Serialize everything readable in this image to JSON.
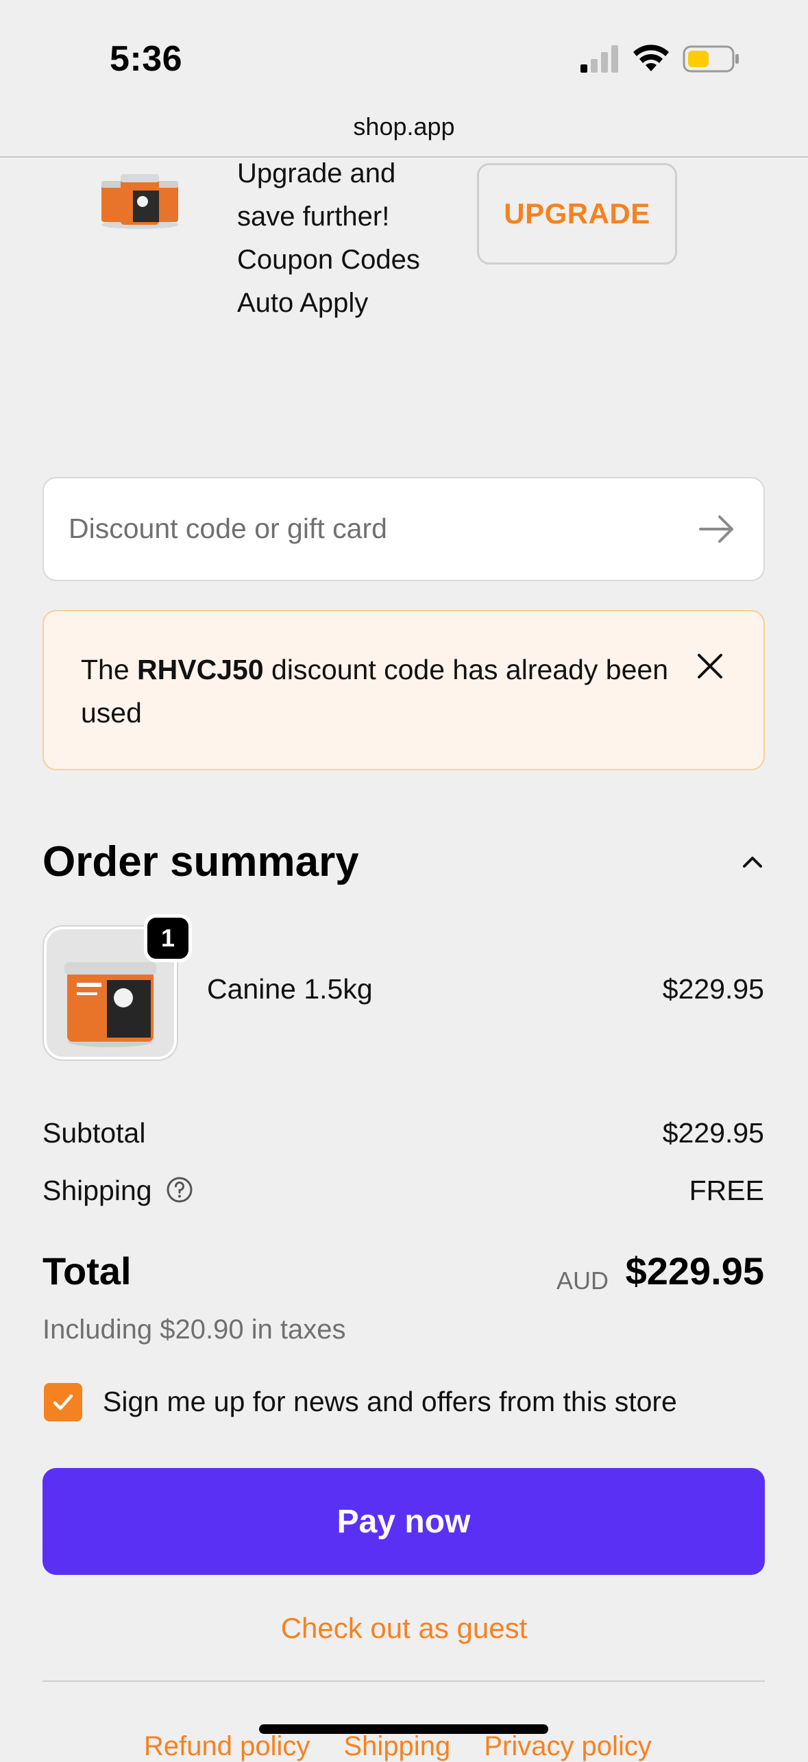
{
  "status_bar": {
    "time": "5:36",
    "battery_color": "#ffcc00"
  },
  "url_bar": {
    "url": "shop.app"
  },
  "upsell": {
    "text": "Upgrade and save further! Coupon Codes Auto Apply",
    "button_label": "UPGRADE"
  },
  "discount": {
    "placeholder": "Discount code or gift card"
  },
  "alert": {
    "prefix": "The ",
    "code": "RHVCJ50",
    "suffix": " discount code has already been used"
  },
  "order_summary": {
    "title": "Order summary",
    "items": [
      {
        "name": "Canine 1.5kg",
        "price": "$229.95",
        "quantity": "1"
      }
    ],
    "subtotal_label": "Subtotal",
    "subtotal_value": "$229.95",
    "shipping_label": "Shipping",
    "shipping_value": "FREE",
    "total_label": "Total",
    "total_currency": "AUD",
    "total_value": "$229.95",
    "taxes_text": "Including $20.90 in taxes"
  },
  "newsletter": {
    "label": "Sign me up for news and offers from this store",
    "checked": true
  },
  "actions": {
    "pay_label": "Pay now",
    "guest_label": "Check out as guest"
  },
  "footer": {
    "links": [
      "Refund policy",
      "Shipping",
      "Privacy policy"
    ]
  },
  "colors": {
    "accent": "#f58220",
    "pay_button": "#5a31f4",
    "alert_background": "#fff4eb",
    "alert_border": "#f8cf9a"
  }
}
